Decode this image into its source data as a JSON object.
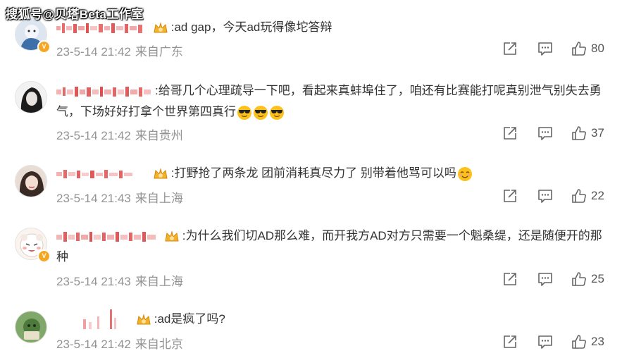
{
  "watermark": "搜狐号@贝塔Beta工作室",
  "comments": [
    {
      "text": ":ad gap，今天ad玩得像坨答辩",
      "time": "23-5-14 21:42",
      "location": "来自广东",
      "likes": "80",
      "verified": true
    },
    {
      "text": ":给哥几个心理疏导一下吧，看起来真蚌埠住了，咱还有比赛能打呢真别泄气别失去勇气，下场好好打拿个世界第四真行",
      "time": "23-5-14 21:42",
      "location": "来自贵州",
      "likes": "37",
      "verified": false
    },
    {
      "text": ":打野抢了两条龙 团前消耗真尽力了 别带着他骂可以吗",
      "time": "23-5-14 21:43",
      "location": "来自上海",
      "likes": "22",
      "verified": false
    },
    {
      "text": ":为什么我们切AD那么难，而开我方AD对方只需要一个魁桑缇，还是随便开的那种",
      "time": "23-5-14 21:43",
      "location": "来自上海",
      "likes": "25",
      "verified": true
    },
    {
      "text": ":ad是疯了吗?",
      "time": "23-5-14 21:42",
      "location": "来自北京",
      "likes": "23",
      "verified": false
    }
  ],
  "icons": {
    "share": "share-icon",
    "comment": "comment-icon",
    "like": "thumbs-up-icon",
    "crown": "crown-icon",
    "verified": "verified-badge-icon"
  },
  "colors": {
    "meta": "#939393",
    "text": "#333333",
    "badge": "#f5a623",
    "icon": "#666666"
  }
}
